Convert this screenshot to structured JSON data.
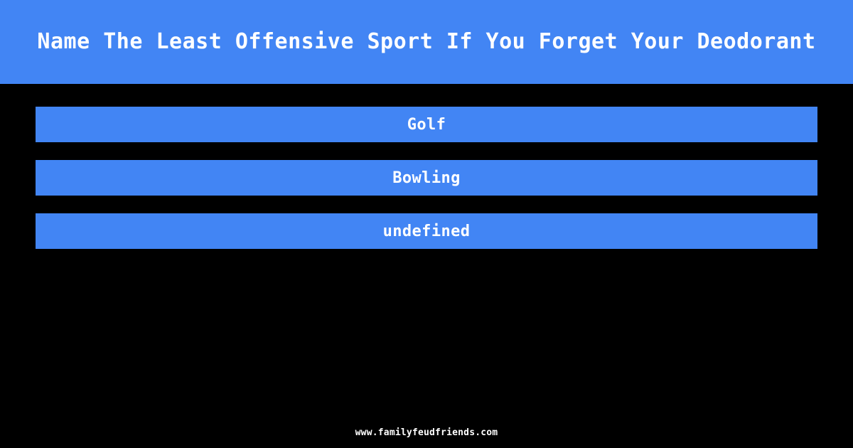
{
  "theme": {
    "background_color": "#000000",
    "accent_color": "#4285f4",
    "text_color": "#ffffff"
  },
  "header": {
    "title": "Name The Least Offensive Sport If You Forget Your Deodorant"
  },
  "answers": {
    "items": [
      {
        "label": "Golf"
      },
      {
        "label": "Bowling"
      },
      {
        "label": "undefined"
      }
    ]
  },
  "footer": {
    "url": "www.familyfeudfriends.com"
  }
}
